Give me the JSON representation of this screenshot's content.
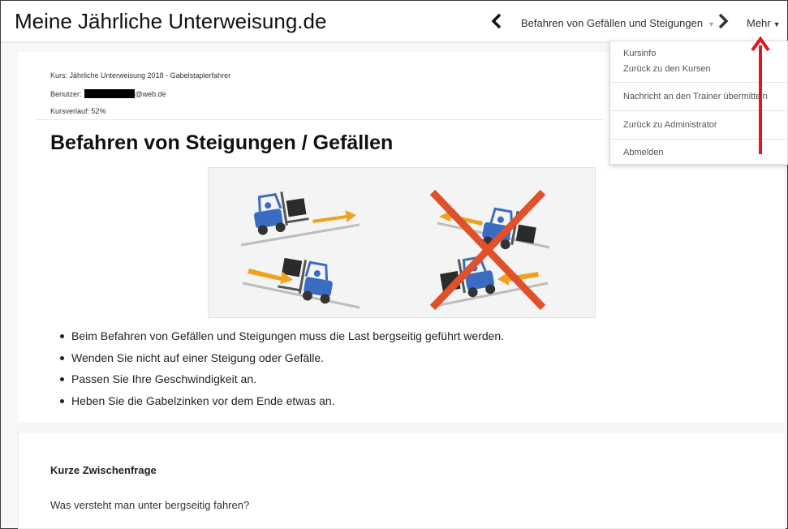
{
  "header": {
    "site_title": "Meine Jährliche Unterweisung.de",
    "current_lesson": "Befahren von Gefällen und Steigungen",
    "more_label": "Mehr"
  },
  "course_info": {
    "kurs": "Kurs: Jährliche Unterweisung 2018 - Gabelstaplerfahrer",
    "user_prefix": "Benutzer:",
    "user_suffix": "@web.de",
    "progress": "Kursverlauf: 52%"
  },
  "lesson": {
    "title": "Befahren von Steigungen / Gefällen",
    "bullets": [
      "Beim Befahren von Gefällen und Steigungen muss die Last bergseitig geführt werden.",
      "Wenden Sie nicht auf einer Steigung oder Gefälle.",
      "Passen Sie Ihre Geschwindigkeit an.",
      "Heben Sie die Gabelzinken vor dem Ende etwas an."
    ]
  },
  "question": {
    "heading": "Kurze Zwischenfrage",
    "text": "Was versteht man unter bergseitig fahren?"
  },
  "dropdown_menu": {
    "items": [
      "Kursinfo",
      "Zurück zu den Kursen",
      "Nachricht an den Trainer übermitteln",
      "Zurück zu Administrator",
      "Abmelden"
    ]
  },
  "colors": {
    "forklift_blue": "#3b6cc4",
    "arrow_orange": "#f0a11e",
    "cross_red": "#e0502a",
    "annotation_red": "#e8141c"
  }
}
